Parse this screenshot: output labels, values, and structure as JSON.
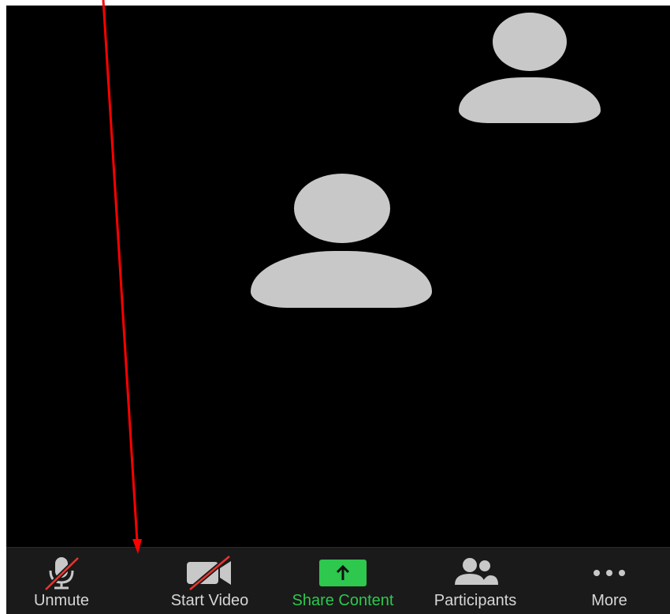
{
  "toolbar": {
    "unmute": {
      "label": "Unmute",
      "icon": "microphone-muted-icon"
    },
    "start_video": {
      "label": "Start Video",
      "icon": "video-camera-off-icon"
    },
    "share_content": {
      "label": "Share Content",
      "icon": "share-upload-icon"
    },
    "participants": {
      "label": "Participants",
      "icon": "participants-icon"
    },
    "more": {
      "label": "More",
      "icon": "more-dots-icon"
    }
  },
  "colors": {
    "video_background": "#000000",
    "toolbar_background": "#1a1a1a",
    "avatar": "#c9c8c8",
    "label": "#d6d6d6",
    "share_accent": "#2dc84d",
    "mute_slash": "#e8352f",
    "annotation_arrow": "#ff0000"
  },
  "participants_shown": [
    {
      "name": "participant-avatar-1",
      "icon": "person-placeholder-icon"
    },
    {
      "name": "participant-avatar-2",
      "icon": "person-placeholder-icon"
    }
  ]
}
